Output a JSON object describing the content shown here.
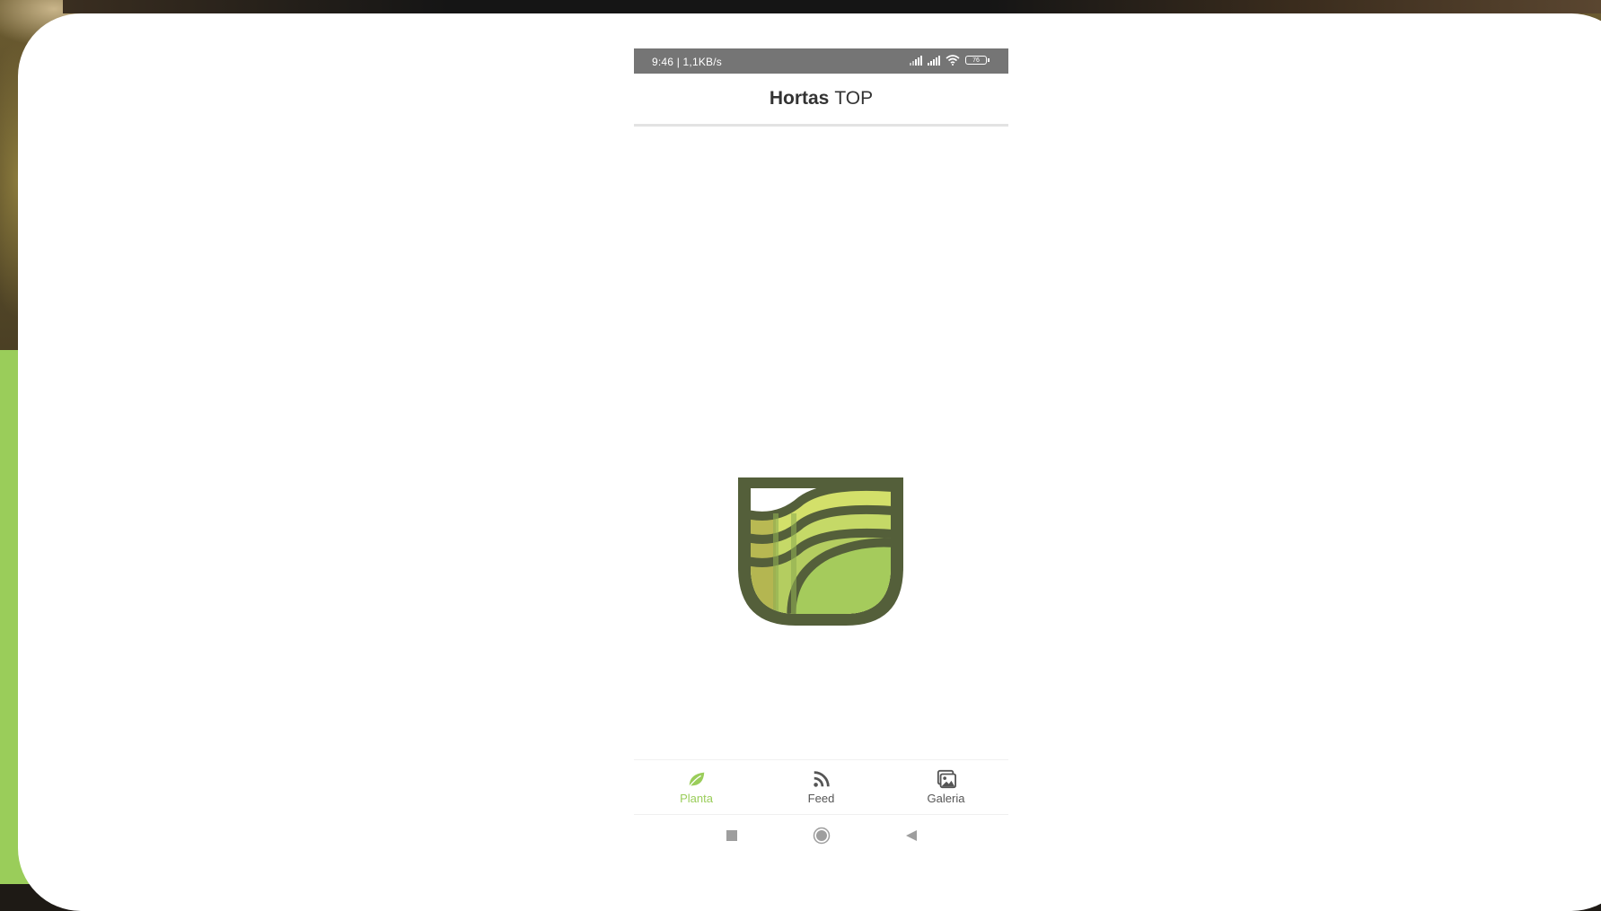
{
  "status_bar": {
    "time_speed": "9:46 | 1,1KB/s",
    "battery_level": "76"
  },
  "app_bar": {
    "title_bold": "Hortas",
    "title_regular": "TOP"
  },
  "logo": {
    "icon": "hortas-logo-icon",
    "colors": {
      "outline": "#545f3a",
      "light_green": "#d3e06a",
      "mid_green": "#a5cb5c",
      "olive": "#b4b24f"
    }
  },
  "bottom_nav": {
    "items": [
      {
        "label": "Planta",
        "icon": "leaf-icon",
        "active": true
      },
      {
        "label": "Feed",
        "icon": "rss-feed-icon",
        "active": false
      },
      {
        "label": "Galeria",
        "icon": "gallery-icon",
        "active": false
      }
    ],
    "active_color": "#9acd5a"
  },
  "system_nav": {
    "buttons": [
      "recents-square-icon",
      "home-circle-icon",
      "back-triangle-icon"
    ]
  }
}
